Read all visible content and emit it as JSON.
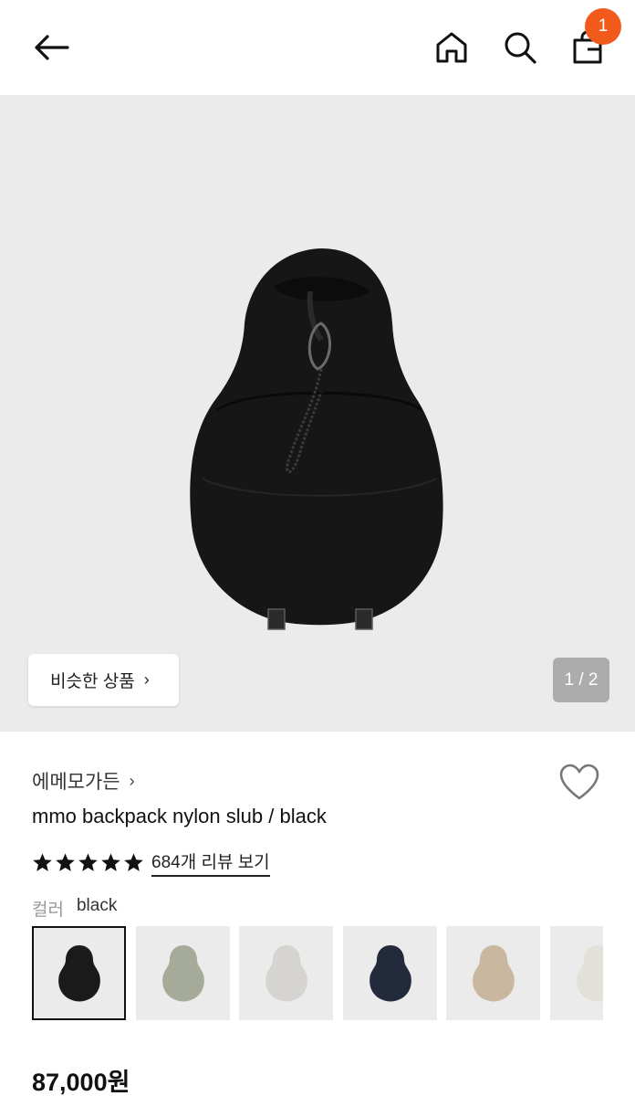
{
  "header": {
    "back_icon": "arrow-left-icon",
    "home_icon": "home-icon",
    "search_icon": "search-icon",
    "cart_icon": "shopping-bag-icon",
    "cart_count": "1",
    "badge_color": "#f25a1c"
  },
  "hero": {
    "similar_label": "비슷한 상품",
    "pager": "1 / 2",
    "background": "#ebebeb"
  },
  "product": {
    "brand": "에메모가든",
    "title": "mmo backpack nylon slub / black",
    "rating_stars": 5,
    "review_link": "684개 리뷰 보기",
    "color_label": "컬러",
    "color_value": "black",
    "colors": [
      {
        "name": "black",
        "hex": "#1a1a1a",
        "selected": true
      },
      {
        "name": "sage",
        "hex": "#a5ab98",
        "selected": false
      },
      {
        "name": "light grey",
        "hex": "#d6d4d0",
        "selected": false
      },
      {
        "name": "navy",
        "hex": "#232a3b",
        "selected": false
      },
      {
        "name": "beige",
        "hex": "#c9b89f",
        "selected": false
      },
      {
        "name": "ivory",
        "hex": "#e2e0d8",
        "selected": false
      }
    ],
    "price": "87,000원"
  }
}
